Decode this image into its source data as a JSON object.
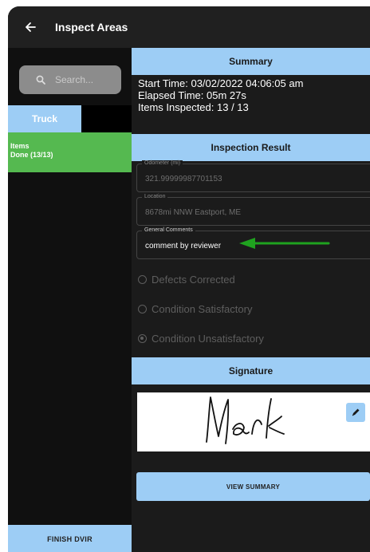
{
  "header": {
    "title": "Inspect Areas",
    "back_icon": "arrow-left-icon"
  },
  "sidebar": {
    "search_placeholder": "Search...",
    "tabs": [
      {
        "label": "Truck",
        "active": true
      }
    ],
    "items_row": {
      "title": "Items",
      "status": "Done (13/13)"
    },
    "finish_button": "FINISH DVIR"
  },
  "summary": {
    "header": "Summary",
    "start_time": "Start Time: 03/02/2022 04:06:05 am",
    "elapsed_time": "Elapsed Time: 05m 27s",
    "items_inspected": "Items Inspected: 13 / 13"
  },
  "inspection_result": {
    "header": "Inspection Result",
    "odometer": {
      "label": "Odometer (mi)",
      "value": "321.99999987701153"
    },
    "location": {
      "label": "Location",
      "value": "8678mi NNW Eastport, ME"
    },
    "general_comments": {
      "label": "General Comments",
      "value": "comment by reviewer"
    },
    "options": [
      {
        "label": "Defects Corrected",
        "selected": false
      },
      {
        "label": "Condition Satisfactory",
        "selected": false
      },
      {
        "label": "Condition Unsatisfactory",
        "selected": true
      }
    ]
  },
  "signature": {
    "header": "Signature",
    "signed_name": "Mark",
    "edit_icon": "pencil-icon"
  },
  "view_summary_button": "VIEW SUMMARY",
  "colors": {
    "accent": "#9dcdf5",
    "success": "#55b950",
    "background": "#1b1b1b",
    "annotation_arrow": "#1fa21f"
  }
}
